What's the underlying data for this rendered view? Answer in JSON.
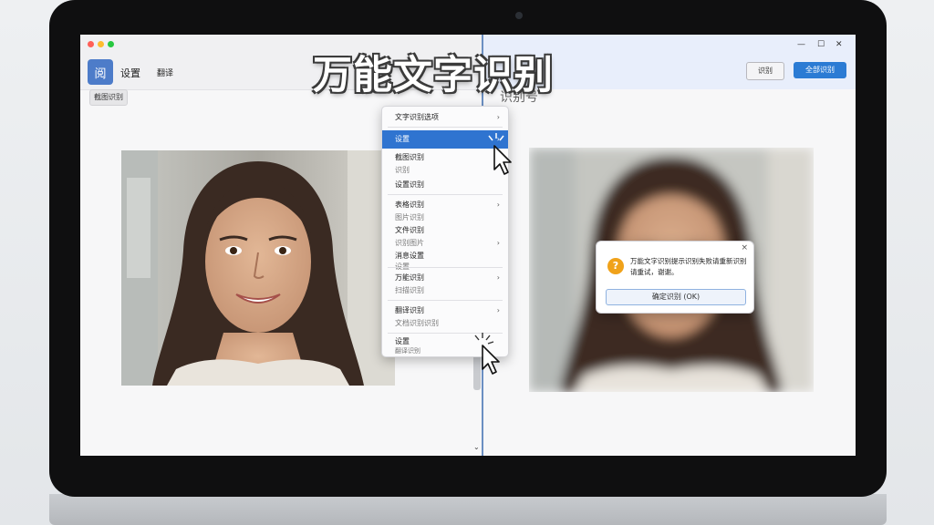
{
  "overlay": {
    "title": "万能文字识别",
    "ghost_text": "识别号"
  },
  "left_window": {
    "app_icon_char": "阅",
    "toolbar_item_1": "设置",
    "toolbar_item_2": "翻译",
    "small_button": "截图识别"
  },
  "context_menu": {
    "items": [
      {
        "label": "文字识别选项",
        "arrow": "›"
      },
      {
        "label": "设置",
        "arrow": "›"
      },
      {
        "label": "截图识别",
        "arrow": ""
      },
      {
        "label": "识别",
        "arrow": ""
      },
      {
        "label": "设置识别",
        "arrow": ""
      },
      {
        "label": "表格识别",
        "arrow": "›"
      },
      {
        "label": "图片识别",
        "arrow": ""
      },
      {
        "label": "文件识别",
        "arrow": ""
      },
      {
        "label": "识别图片",
        "arrow": "›"
      },
      {
        "label": "消息设置",
        "arrow": ""
      },
      {
        "label": "设置",
        "arrow": ""
      },
      {
        "label": "万能识别",
        "arrow": "›"
      },
      {
        "label": "扫描识别",
        "arrow": ""
      },
      {
        "label": "翻译识别",
        "arrow": "›"
      },
      {
        "label": "文档识别识别",
        "arrow": ""
      },
      {
        "label": "设置",
        "arrow": "›"
      },
      {
        "label": "翻译识别",
        "arrow": ""
      }
    ]
  },
  "right_window": {
    "button_1": "识别",
    "button_2": "全部识别"
  },
  "dialog": {
    "line_1": "万能文字识别提示识别失败请重新识别",
    "line_2": "请重试，谢谢。",
    "button": "确定识别 (OK)",
    "close": "×"
  },
  "colors": {
    "accent": "#2f74d0",
    "warning": "#f0a21a",
    "bezel": "#0f0f10"
  }
}
